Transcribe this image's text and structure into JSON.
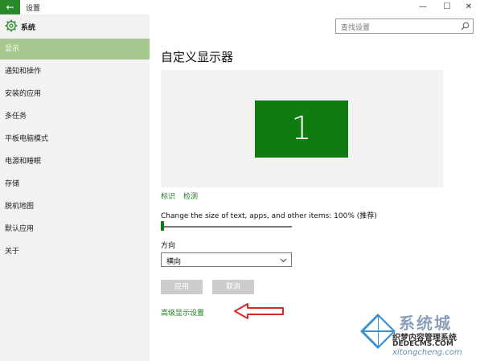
{
  "window": {
    "title": "设置",
    "back_glyph": "←",
    "minimize_glyph": "—",
    "maximize_glyph": "☐",
    "close_glyph": "✕"
  },
  "sidebar": {
    "header": "系统",
    "items": [
      {
        "label": "显示",
        "active": true
      },
      {
        "label": "通知和操作",
        "active": false
      },
      {
        "label": "安装的应用",
        "active": false
      },
      {
        "label": "多任务",
        "active": false
      },
      {
        "label": "平板电脑模式",
        "active": false
      },
      {
        "label": "电源和睡眠",
        "active": false
      },
      {
        "label": "存储",
        "active": false
      },
      {
        "label": "脱机地图",
        "active": false
      },
      {
        "label": "默认应用",
        "active": false
      },
      {
        "label": "关于",
        "active": false
      }
    ]
  },
  "search": {
    "placeholder": "查找设置"
  },
  "main": {
    "title": "自定义显示器",
    "monitor_number": "1",
    "identify_link": "标识",
    "detect_link": "检测",
    "scale_label": "Change the size of text, apps, and other items: 100% (推荐)",
    "scale_level": 0.0,
    "orientation_label": "方向",
    "orientation_value": "横向",
    "apply_button": "应用",
    "cancel_button": "取消",
    "advanced_link": "高级显示设置"
  },
  "watermark": {
    "brand": "系统城",
    "line1": "织梦内容管理系统",
    "line2": "DEDECMS.COM",
    "line3": "xitongcheng.com"
  },
  "colors": {
    "accent": "#107c10",
    "active_nav": "#a6c88f",
    "arrow": "#d42a2a"
  }
}
